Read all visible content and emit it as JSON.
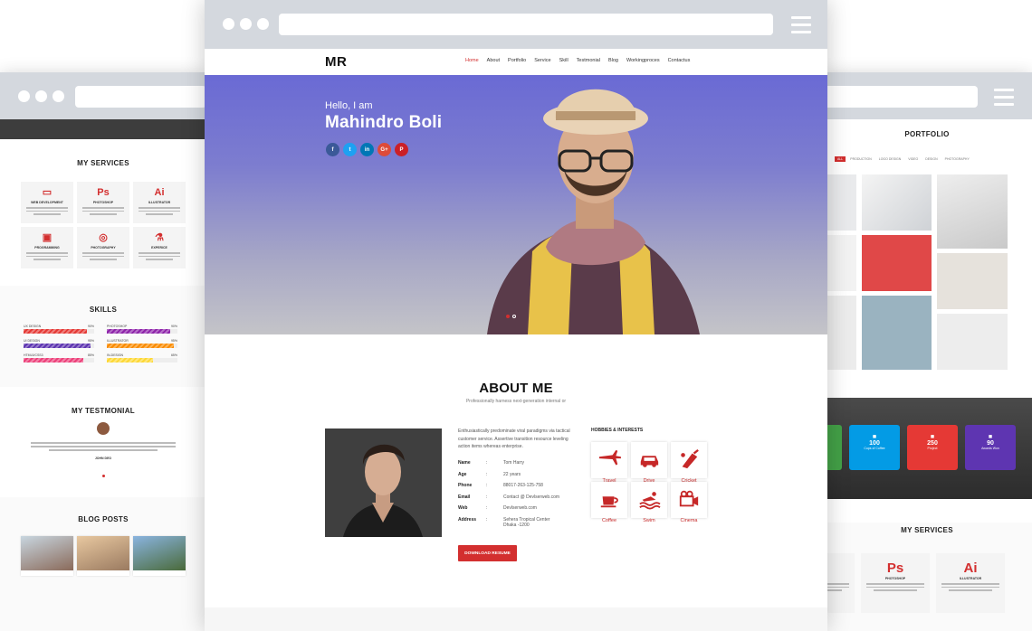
{
  "main": {
    "logo": "MR",
    "nav": [
      "Home",
      "About",
      "Portfolio",
      "Service",
      "Skill",
      "Testmonial",
      "Blog",
      "Workingproces",
      "Contactus"
    ],
    "hero": {
      "greeting": "Hello, I am",
      "name": "Mahindro Boli",
      "socials": [
        "f",
        "t",
        "in",
        "G+",
        "P"
      ]
    },
    "about": {
      "title": "ABOUT ME",
      "subtitle": "Professionally harness next-generation internal or",
      "intro": "Enthusiastically predominate viral paradigms via tactical customer service. Assertive transition resource leveling action items whereas enterprise.",
      "info": [
        {
          "key": "Name",
          "value": "Tom Harry"
        },
        {
          "key": "Age",
          "value": "22 years"
        },
        {
          "key": "Phone",
          "value": "88017-263-125-758"
        },
        {
          "key": "Email",
          "value": "Contact @ Devlserweb.com"
        },
        {
          "key": "Web",
          "value": "Devlserweb.com"
        },
        {
          "key": "Address",
          "value": "Sehera Tropical Center\nDhaka -1200"
        }
      ],
      "download_label": "DOWNLOAD RESUME",
      "hobbies_title": "HOBBIES & INTERESTS",
      "hobbies": [
        {
          "label": "Travel",
          "icon": "plane-icon"
        },
        {
          "label": "Drive",
          "icon": "car-icon"
        },
        {
          "label": "Cricket",
          "icon": "cricket-bat-icon"
        },
        {
          "label": "Coffee",
          "icon": "coffee-cup-icon"
        },
        {
          "label": "Swim",
          "icon": "swimmer-icon"
        },
        {
          "label": "Cinema",
          "icon": "video-camera-icon"
        }
      ]
    }
  },
  "left": {
    "services": {
      "title": "MY SERVICES",
      "items": [
        {
          "icon": "web-icon",
          "name": "WEB DEVELOPMENT"
        },
        {
          "icon": "Ps",
          "name": "PHOTOSHOP"
        },
        {
          "icon": "Ai",
          "name": "ILLUSTRATOR"
        },
        {
          "icon": "monitor-icon",
          "name": "PROGRAMMING"
        },
        {
          "icon": "camera-icon",
          "name": "PHOTOGRAPHY"
        },
        {
          "icon": "flask-icon",
          "name": "EXPERICE"
        }
      ]
    },
    "skills": {
      "title": "SKILLS",
      "items": [
        {
          "name": "UX DESIGN",
          "value": 90,
          "color": "#e53935"
        },
        {
          "name": "PHOTOSHOP",
          "value": 90,
          "color": "#8e24aa"
        },
        {
          "name": "UI DESIGN",
          "value": 95,
          "color": "#5e35b1"
        },
        {
          "name": "ILLUSTRATOR",
          "value": 95,
          "color": "#fb8c00"
        },
        {
          "name": "HTML5/CSS3",
          "value": 85,
          "color": "#ec407a"
        },
        {
          "name": "IN-DESIGN",
          "value": 65,
          "color": "#fdd835"
        }
      ]
    },
    "testimonial": {
      "title": "MY TESTMONIAL",
      "author": "JOHN DEO"
    },
    "blog": {
      "title": "BLOG POSTS"
    }
  },
  "right": {
    "portfolio": {
      "title": "PORTFOLIO",
      "tabs": [
        "ALL",
        "PRODUCTION",
        "LOGO DESIGN",
        "VIDEO",
        "DESIGN",
        "PHOTOGRAPHY"
      ]
    },
    "counters": [
      {
        "num": "",
        "label": "",
        "color": "#43a047"
      },
      {
        "num": "100",
        "label": "Cups of Coffee",
        "color": "#039be5"
      },
      {
        "num": "250",
        "label": "Project",
        "color": "#e53935"
      },
      {
        "num": "90",
        "label": "Awards Won",
        "color": "#5e35b1"
      }
    ],
    "services": {
      "title": "MY SERVICES",
      "items": [
        {
          "icon": "",
          "name": "MENT"
        },
        {
          "icon": "Ps",
          "name": "PHOTOSHOP"
        },
        {
          "icon": "Ai",
          "name": "ILLUSTRATOR"
        }
      ]
    }
  }
}
